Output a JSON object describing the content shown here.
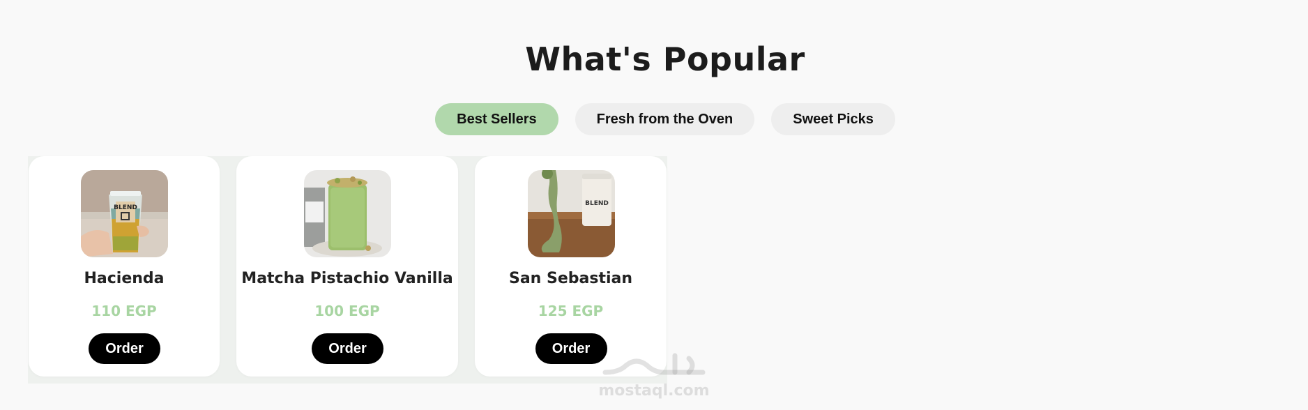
{
  "section": {
    "title": "What's Popular"
  },
  "tabs": [
    {
      "label": "Best Sellers",
      "active": true
    },
    {
      "label": "Fresh from the Oven",
      "active": false
    },
    {
      "label": "Sweet Picks",
      "active": false
    }
  ],
  "products": [
    {
      "name": "Hacienda",
      "price": "110 EGP",
      "order_label": "Order",
      "image_icon": "iced-drink-photo"
    },
    {
      "name": "Matcha Pistachio Vanilla",
      "price": "100 EGP",
      "order_label": "Order",
      "image_icon": "matcha-drink-photo"
    },
    {
      "name": "San Sebastian",
      "price": "125 EGP",
      "order_label": "Order",
      "image_icon": "cheesecake-photo"
    }
  ],
  "watermark": {
    "text": "mostaql.com"
  },
  "colors": {
    "background": "#f9f9f9",
    "active_tab": "#b1d8ac",
    "inactive_tab": "#eeeeee",
    "price": "#a8d5a2",
    "order_button": "#000000"
  }
}
